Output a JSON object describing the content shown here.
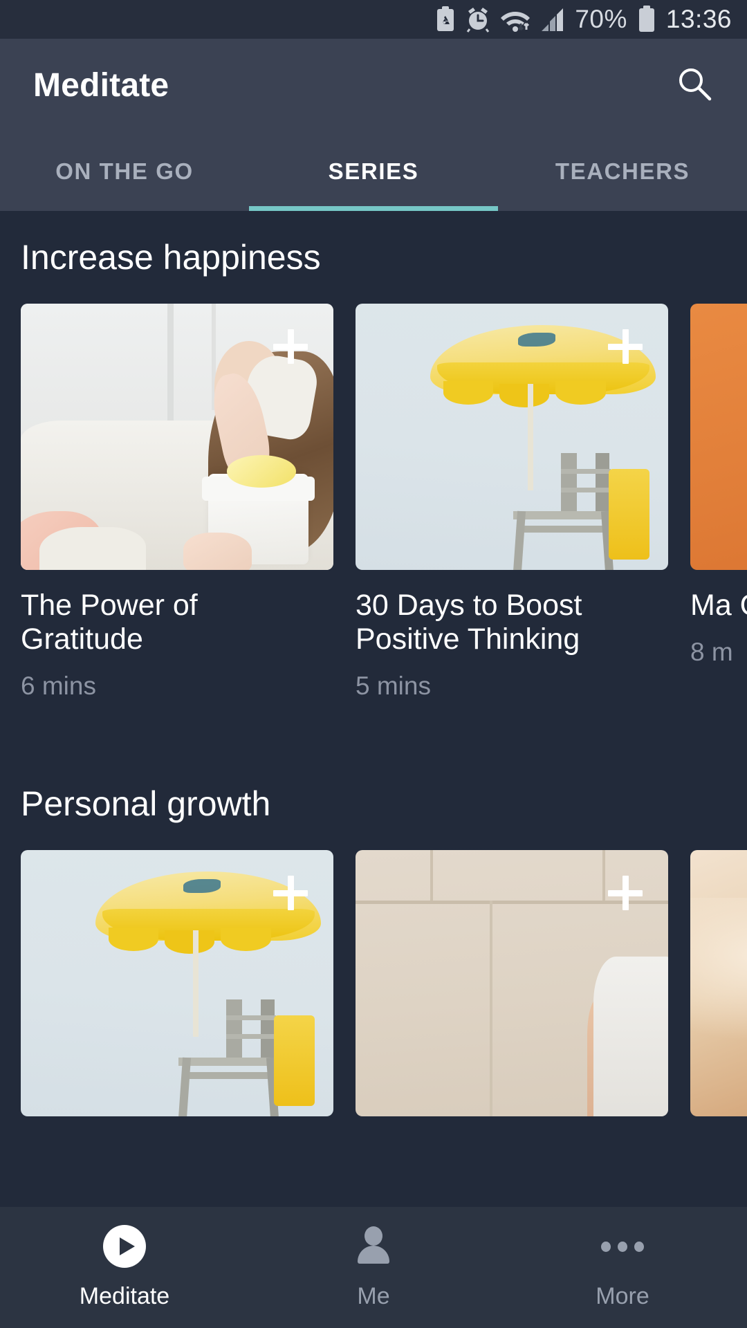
{
  "status_bar": {
    "icons": [
      "sd-card-icon",
      "alarm-clock-icon",
      "wifi-icon",
      "cellular-signal-icon"
    ],
    "battery_percent": "70%",
    "battery_icon": "battery-icon",
    "time": "13:36"
  },
  "app_bar": {
    "title": "Meditate",
    "search_icon": "search-icon"
  },
  "tabs": [
    {
      "label": "ON THE GO",
      "active": false
    },
    {
      "label": "SERIES",
      "active": true
    },
    {
      "label": "TEACHERS",
      "active": false
    }
  ],
  "accent_color": "#76c7c6",
  "background_color": "#222a3a",
  "app_bar_color": "#3b4253",
  "sections": [
    {
      "title": "Increase happiness",
      "cards": [
        {
          "title": "The Power of Gratitude",
          "duration": "6 mins",
          "add_icon": "plus-icon"
        },
        {
          "title": "30 Days to Boost Positive Thinking",
          "duration": "5 mins",
          "add_icon": "plus-icon"
        },
        {
          "title": "Ma Gre",
          "duration": "8 m",
          "add_icon": "plus-icon"
        }
      ]
    },
    {
      "title": "Personal growth",
      "cards": [
        {
          "title": "",
          "duration": "",
          "add_icon": "plus-icon"
        },
        {
          "title": "",
          "duration": "",
          "add_icon": "plus-icon"
        },
        {
          "title": "",
          "duration": "",
          "add_icon": "plus-icon"
        }
      ]
    }
  ],
  "bottom_nav": [
    {
      "label": "Meditate",
      "icon": "play-icon",
      "active": true
    },
    {
      "label": "Me",
      "icon": "person-icon",
      "active": false
    },
    {
      "label": "More",
      "icon": "more-dots-icon",
      "active": false
    }
  ]
}
